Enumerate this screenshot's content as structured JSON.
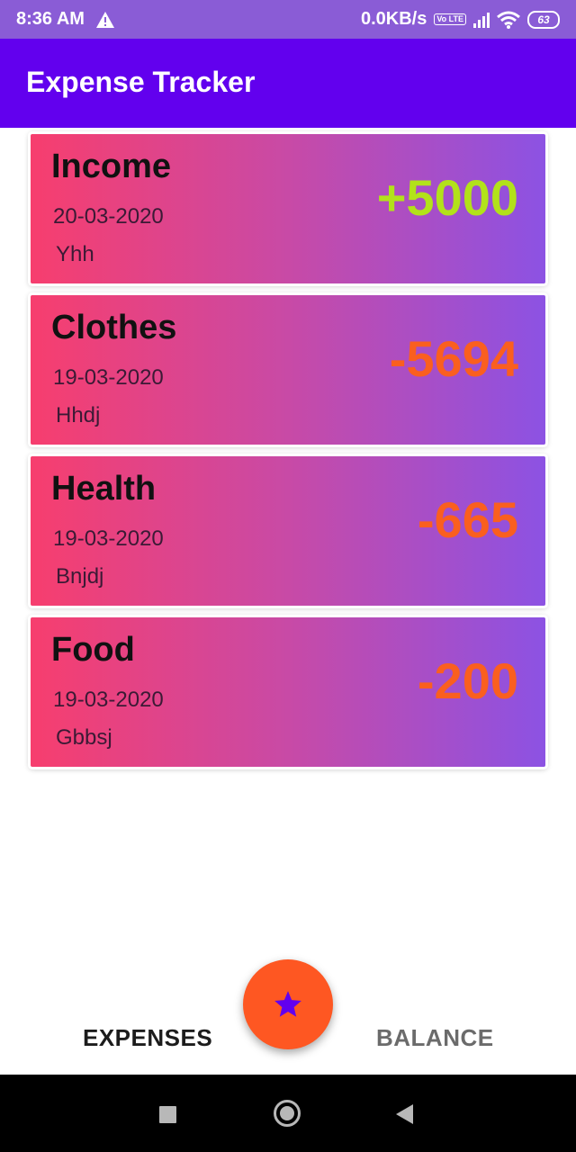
{
  "status_bar": {
    "time": "8:36 AM",
    "network_speed": "0.0KB/s",
    "volte": "Vo LTE",
    "battery": "63",
    "icons": [
      "warning-icon",
      "signal-icon",
      "wifi-icon",
      "battery-icon"
    ]
  },
  "app_bar": {
    "title": "Expense Tracker"
  },
  "transactions": [
    {
      "category": "Income",
      "date": "20-03-2020",
      "note": "Yhh",
      "amount": "+5000",
      "type": "income"
    },
    {
      "category": "Clothes",
      "date": "19-03-2020",
      "note": "Hhdj",
      "amount": "-5694",
      "type": "expense"
    },
    {
      "category": "Health",
      "date": "19-03-2020",
      "note": "Bnjdj",
      "amount": "-665",
      "type": "expense"
    },
    {
      "category": "Food",
      "date": "19-03-2020",
      "note": "Gbbsj",
      "amount": "-200",
      "type": "expense"
    }
  ],
  "bottom_nav": {
    "tabs": [
      {
        "label": "EXPENSES",
        "selected": true
      },
      {
        "label": "BALANCE",
        "selected": false
      }
    ],
    "fab_icon": "star-icon"
  },
  "system_nav": {
    "icons": [
      "recents-icon",
      "home-icon",
      "back-icon"
    ]
  },
  "colors": {
    "app_bar": "#6200ee",
    "status_bar": "#8a5cd6",
    "fab": "#fe5722",
    "positive_amount": "#b2e21a",
    "negative_amount": "#fa5f1f",
    "card_gradient_start": "#f73e6e",
    "card_gradient_end": "#8c52e3"
  }
}
